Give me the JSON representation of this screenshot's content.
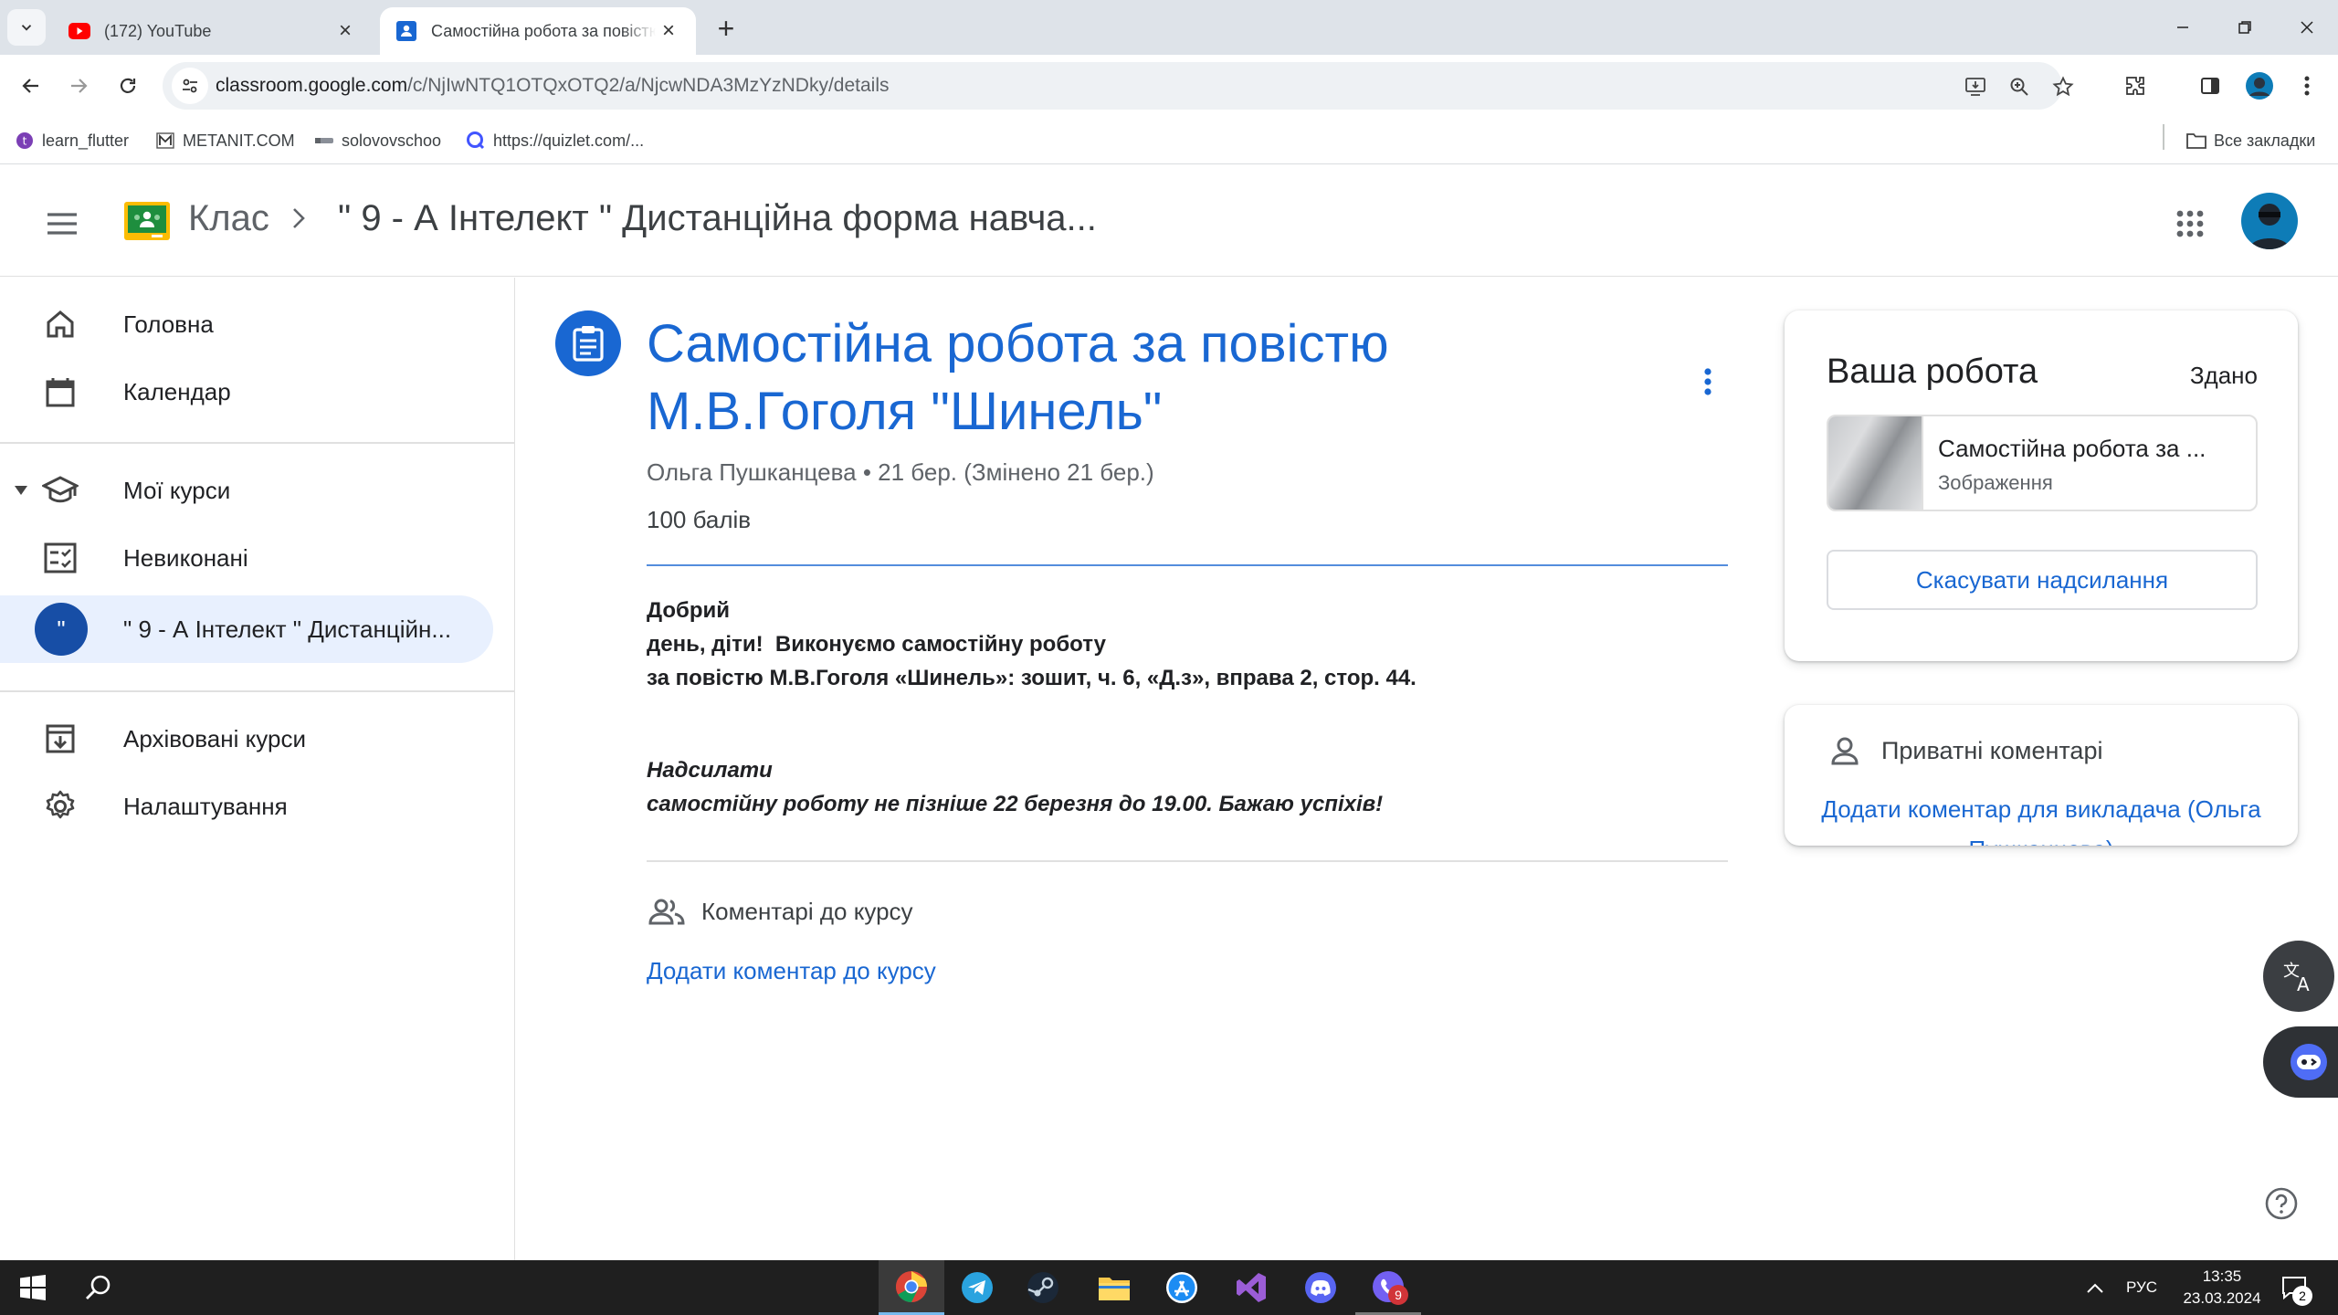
{
  "browser": {
    "tabs": [
      {
        "title": "(172) YouTube",
        "active": false,
        "favicon": "youtube-icon"
      },
      {
        "title": "Самостійна робота за повістю",
        "active": true,
        "favicon": "classroom-icon"
      }
    ],
    "url_host": "classroom.google.com",
    "url_path": "/c/NjIwNTQ1OTQxOTQ2/a/NjcwNDA3MzYzNDky/details",
    "bookmarks": [
      {
        "label": "learn_flutter",
        "icon": "learn-flutter-icon"
      },
      {
        "label": "METANIT.COM",
        "icon": "metanit-icon"
      },
      {
        "label": "solovovschoo",
        "icon": "bookmark-site-icon"
      },
      {
        "label": "https://quizlet.com/...",
        "icon": "quizlet-icon"
      }
    ],
    "all_bookmarks": "Все закладки"
  },
  "header": {
    "brand": "Клас",
    "breadcrumb": "\" 9 - А Інтелект \" Дистанційна форма навча..."
  },
  "sidebar": {
    "items": [
      {
        "label": "Головна",
        "icon": "home-icon"
      },
      {
        "label": "Календар",
        "icon": "calendar-icon"
      },
      {
        "label": "Мої курси",
        "icon": "school-icon"
      },
      {
        "label": "Невиконані",
        "icon": "todo-icon"
      },
      {
        "label": "\" 9 - А Інтелект \" Дистанційн...",
        "icon": "course-avatar",
        "avatar_letter": "\"",
        "selected": true
      },
      {
        "label": "Архівовані курси",
        "icon": "archive-icon"
      },
      {
        "label": "Налаштування",
        "icon": "settings-icon"
      }
    ]
  },
  "assignment": {
    "title": "Самостійна робота за повістю М.В.Гоголя \"Шинель\"",
    "meta": "Ольга Пушканцева • 21 бер. (Змінено 21 бер.)",
    "points": "100 балів",
    "description": [
      "Добрий",
      "день, діти!  Виконуємо самостійну роботу",
      "за повістю М.В.Гоголя «Шинель»: зошит, ч. 6, «Д.з», вправа 2, стор. 44."
    ],
    "description_italic": [
      "Надсилати",
      "самостійну роботу не пізніше 22 березня до 19.00. Бажаю успіхів!"
    ],
    "class_comments_label": "Коментарі до курсу",
    "add_class_comment": "Додати коментар до курсу"
  },
  "your_work": {
    "title": "Ваша робота",
    "status": "Здано",
    "attachment_name": "Самостійна робота за ...",
    "attachment_type": "Зображення",
    "unsubmit_label": "Скасувати надсилання"
  },
  "private_comments": {
    "title": "Приватні коментарі",
    "add_label": "Додати коментар для викладача (Ольга Пушканцева)"
  },
  "taskbar": {
    "apps": [
      "chrome-icon",
      "telegram-icon",
      "steam-icon",
      "file-explorer-icon",
      "app-store-icon",
      "visual-studio-icon",
      "discord-icon",
      "viber-icon"
    ],
    "viber_badge": "9",
    "language": "РУС",
    "time": "13:35",
    "date": "23.03.2024",
    "notifications": "2"
  },
  "colors": {
    "accent": "#1967d2",
    "selected_bg": "#e8f0fe",
    "tabbar": "#dee3e9",
    "taskbar": "#1f1f1f"
  }
}
